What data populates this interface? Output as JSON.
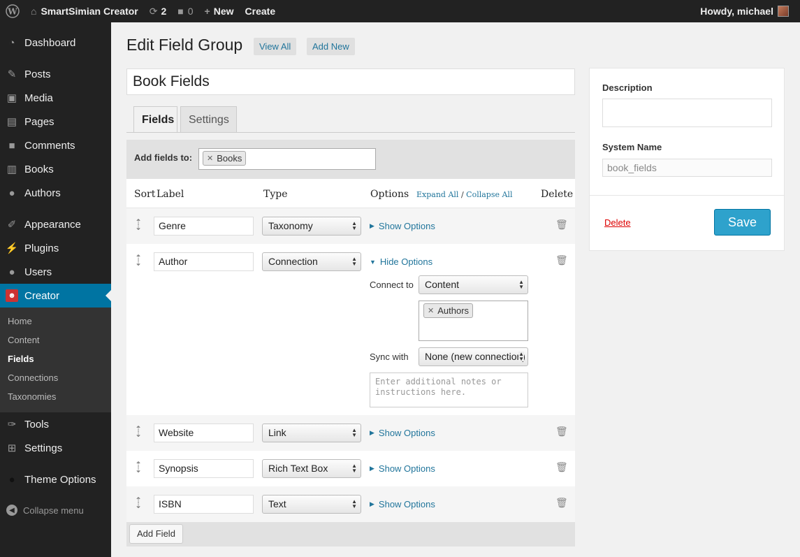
{
  "adminbar": {
    "site_name": "SmartSimian Creator",
    "updates_count": "2",
    "comments_count": "0",
    "new_label": "New",
    "create_label": "Create",
    "howdy": "Howdy, michael"
  },
  "sidebar": {
    "items": [
      {
        "label": "Dashboard",
        "icon": "dashboard-icon"
      },
      {
        "label": "Posts",
        "icon": "pushpin-icon"
      },
      {
        "label": "Media",
        "icon": "media-icon"
      },
      {
        "label": "Pages",
        "icon": "pages-icon"
      },
      {
        "label": "Comments",
        "icon": "comment-icon"
      },
      {
        "label": "Books",
        "icon": "book-icon"
      },
      {
        "label": "Authors",
        "icon": "person-icon"
      },
      {
        "label": "Appearance",
        "icon": "brush-icon"
      },
      {
        "label": "Plugins",
        "icon": "plug-icon"
      },
      {
        "label": "Users",
        "icon": "users-icon"
      },
      {
        "label": "Creator",
        "icon": "creator-monkey-icon"
      },
      {
        "label": "Tools",
        "icon": "wrench-icon"
      },
      {
        "label": "Settings",
        "icon": "settings-icon"
      },
      {
        "label": "Theme Options",
        "icon": "circle-icon"
      }
    ],
    "submenu": [
      "Home",
      "Content",
      "Fields",
      "Connections",
      "Taxonomies"
    ],
    "current_submenu": "Fields",
    "collapse_label": "Collapse menu"
  },
  "header": {
    "title": "Edit Field Group",
    "view_all": "View All",
    "add_new": "Add New"
  },
  "group_title": "Book Fields",
  "tabs": [
    {
      "label": "Fields",
      "active": true
    },
    {
      "label": "Settings",
      "active": false
    }
  ],
  "fields_panel": {
    "add_fields_to_label": "Add fields to:",
    "add_fields_to_tokens": [
      "Books"
    ],
    "columns": {
      "sort": "Sort",
      "label": "Label",
      "type": "Type",
      "options": "Options",
      "expand_all": "Expand All",
      "separator": "/",
      "collapse_all": "Collapse All",
      "delete": "Delete"
    },
    "rows": [
      {
        "label": "Genre",
        "type": "Taxonomy",
        "toggle": "Show Options"
      },
      {
        "label": "Author",
        "type": "Connection",
        "toggle": "Hide Options"
      },
      {
        "label": "Website",
        "type": "Link",
        "toggle": "Show Options"
      },
      {
        "label": "Synopsis",
        "type": "Rich Text Box",
        "toggle": "Show Options"
      },
      {
        "label": "ISBN",
        "type": "Text",
        "toggle": "Show Options"
      }
    ],
    "author_options": {
      "connect_to_label": "Connect to",
      "connect_to_value": "Content",
      "connect_tokens": [
        "Authors"
      ],
      "sync_with_label": "Sync with",
      "sync_with_value": "None (new connection)",
      "notes_placeholder": "Enter additional notes or instructions here."
    },
    "add_field_button": "Add Field"
  },
  "sidebox": {
    "description_label": "Description",
    "description_value": "",
    "system_name_label": "System Name",
    "system_name_placeholder": "book_fields",
    "delete_label": "Delete",
    "save_label": "Save"
  },
  "colors": {
    "admin_dark": "#222222",
    "active_menu": "#0074a2",
    "link": "#21759b",
    "save_button": "#2ea2cc",
    "delete_link": "#dd0000"
  }
}
